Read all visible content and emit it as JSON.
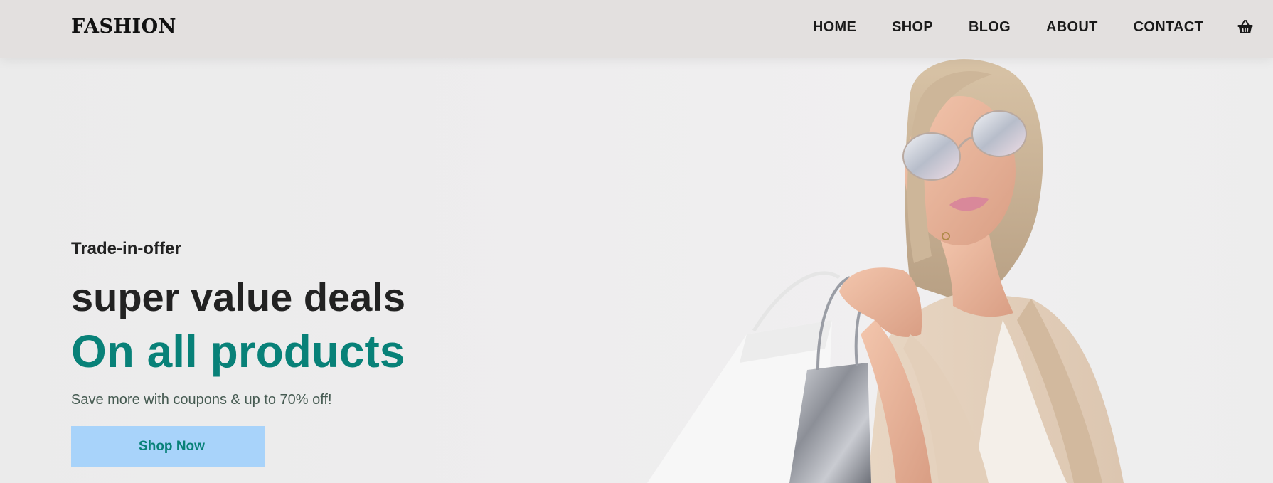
{
  "header": {
    "logo": "FASHION",
    "nav": [
      "HOME",
      "SHOP",
      "BLOG",
      "ABOUT",
      "CONTACT"
    ],
    "cart_icon": "shopping-basket-icon"
  },
  "hero": {
    "subtitle": "Trade-in-offer",
    "headline": "super value deals",
    "headline_accent": "On all products",
    "description": "Save more with coupons & up to 70% off!",
    "button_label": "Shop Now"
  },
  "colors": {
    "accent": "#088178",
    "button_bg": "#a8d3fa",
    "header_bg": "#e3e0df"
  }
}
